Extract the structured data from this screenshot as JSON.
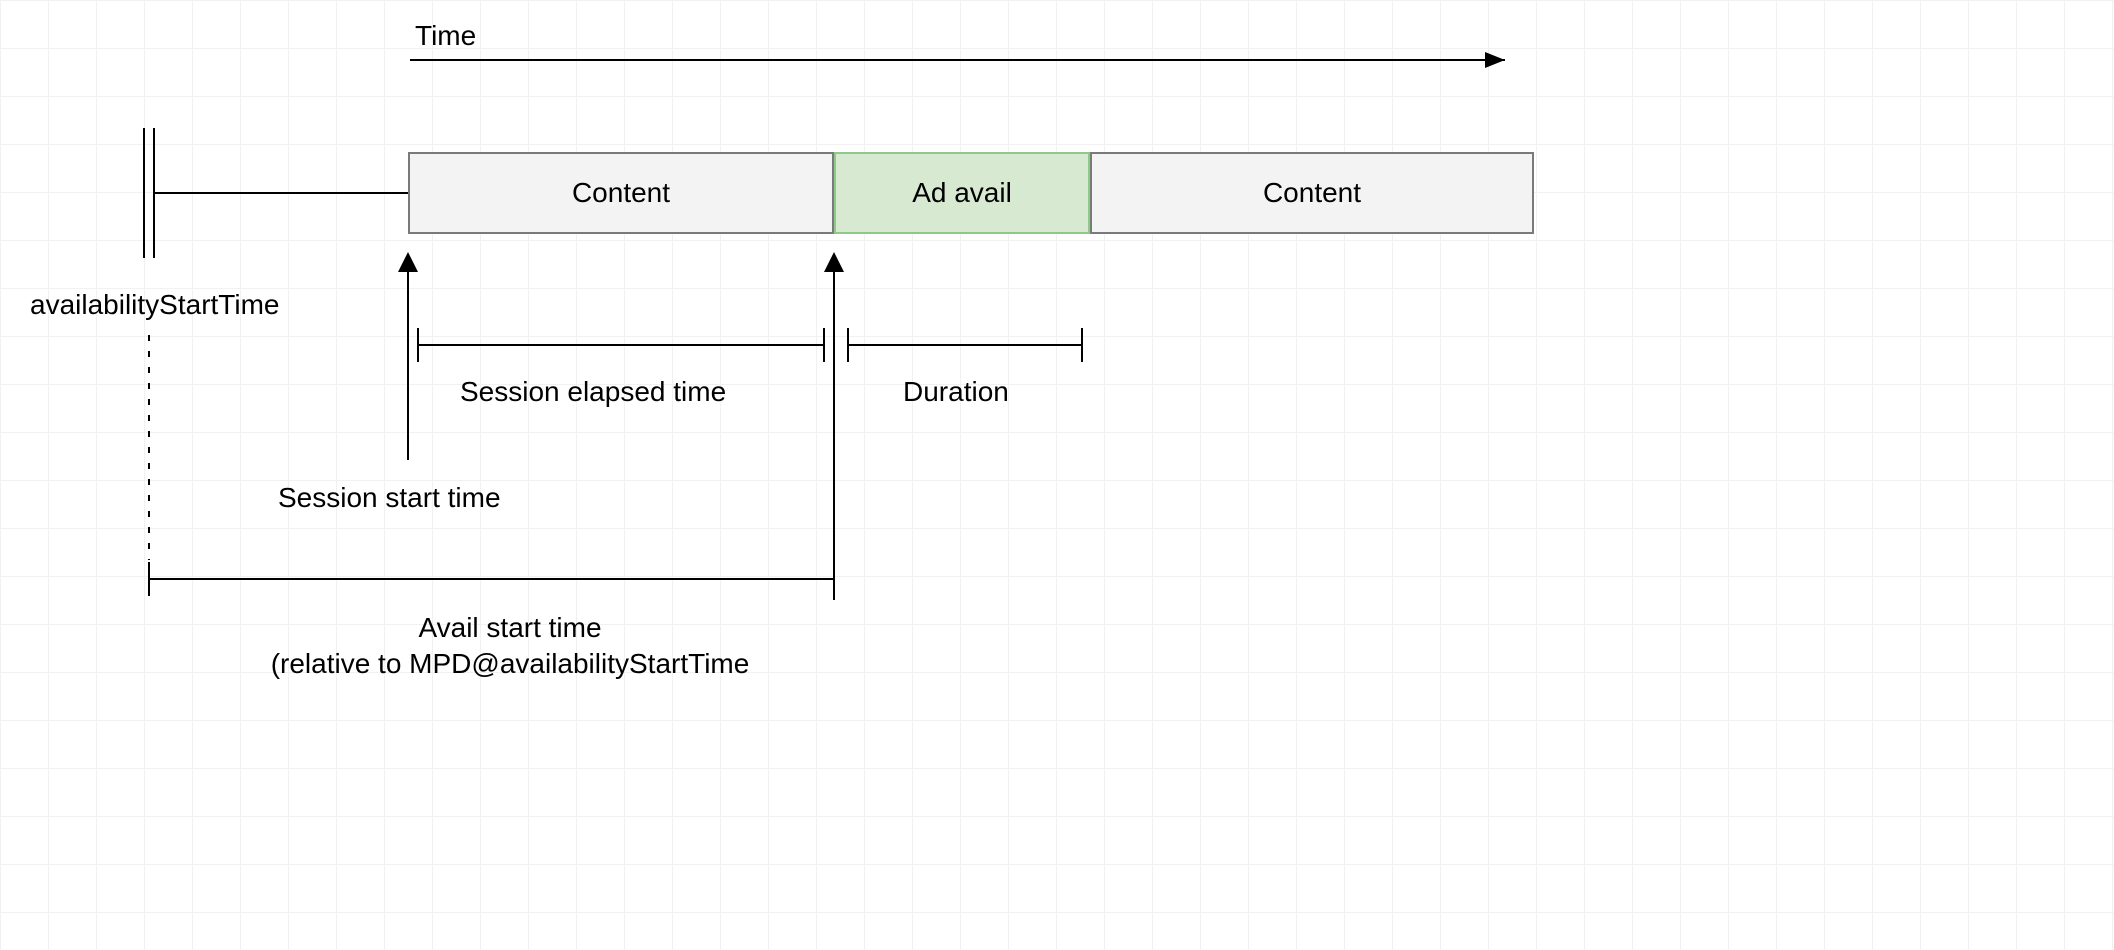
{
  "timeAxis": {
    "label": "Time"
  },
  "availability": {
    "label": "availabilityStartTime"
  },
  "blocks": {
    "content1": "Content",
    "adAvail": "Ad avail",
    "content2": "Content"
  },
  "sessionElapsed": {
    "label": "Session elapsed time"
  },
  "duration": {
    "label": "Duration"
  },
  "sessionStart": {
    "label": "Session start time"
  },
  "availStart": {
    "line1": "Avail start time",
    "line2": "(relative to MPD@availabilityStartTime"
  }
}
